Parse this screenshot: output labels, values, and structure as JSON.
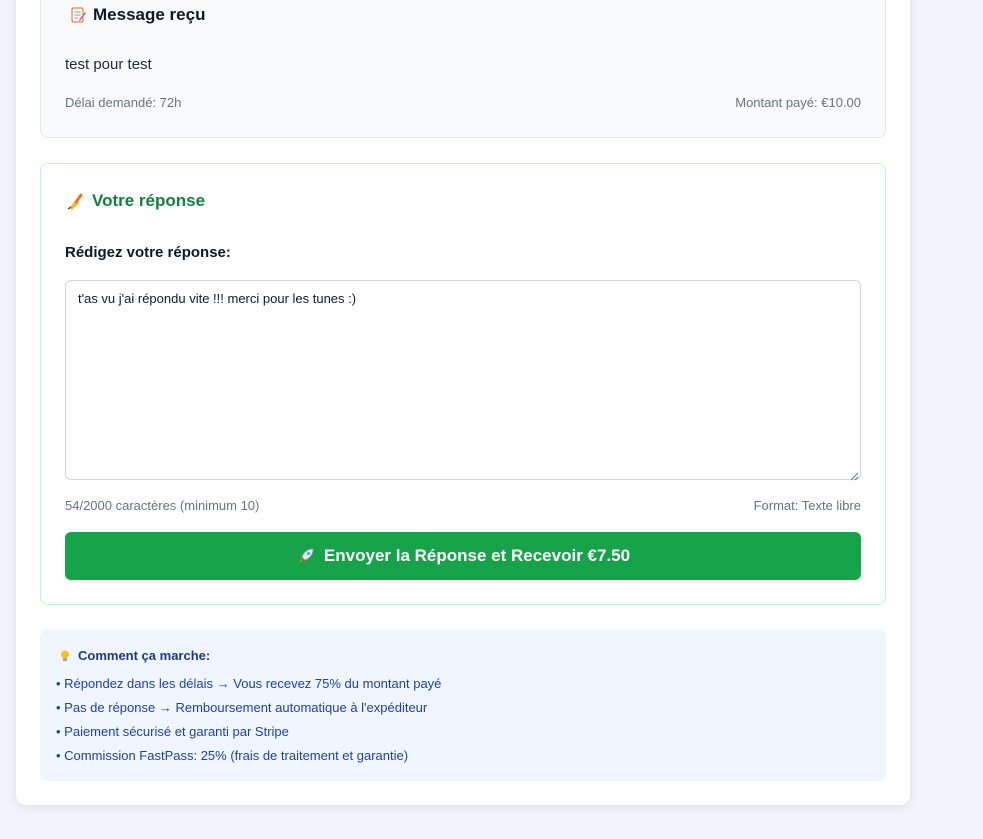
{
  "message": {
    "icon": "memo-icon",
    "title": "Message reçu",
    "body": "test pour test",
    "delay": "Délai demandé: 72h",
    "amount": "Montant payé: €10.00"
  },
  "reply": {
    "icon": "writing-hand-icon",
    "title": "Votre réponse",
    "label": "Rédigez votre réponse:",
    "value": "t'as vu j'ai répondu vite !!! merci pour les tunes :)",
    "char_count": "54/2000 caractères (minimum 10)",
    "format": "Format: Texte libre",
    "submit_icon": "rocket-icon",
    "submit_label": "Envoyer la Réponse et Recevoir €7.50"
  },
  "info": {
    "icon": "lightbulb-icon",
    "title": "Comment ça marche:",
    "items": [
      "• Répondez dans les délais → Vous recevez 75% du montant payé",
      "• Pas de réponse → Remboursement automatique à l'expéditeur",
      "• Paiement sécurisé et garanti par Stripe",
      "• Commission FastPass: 25% (frais de traitement et garantie)"
    ]
  },
  "colors": {
    "accent_green": "#16a34a",
    "title_green": "#15803d",
    "info_blue": "#1e40af",
    "page_bg": "#f3f4fb"
  }
}
